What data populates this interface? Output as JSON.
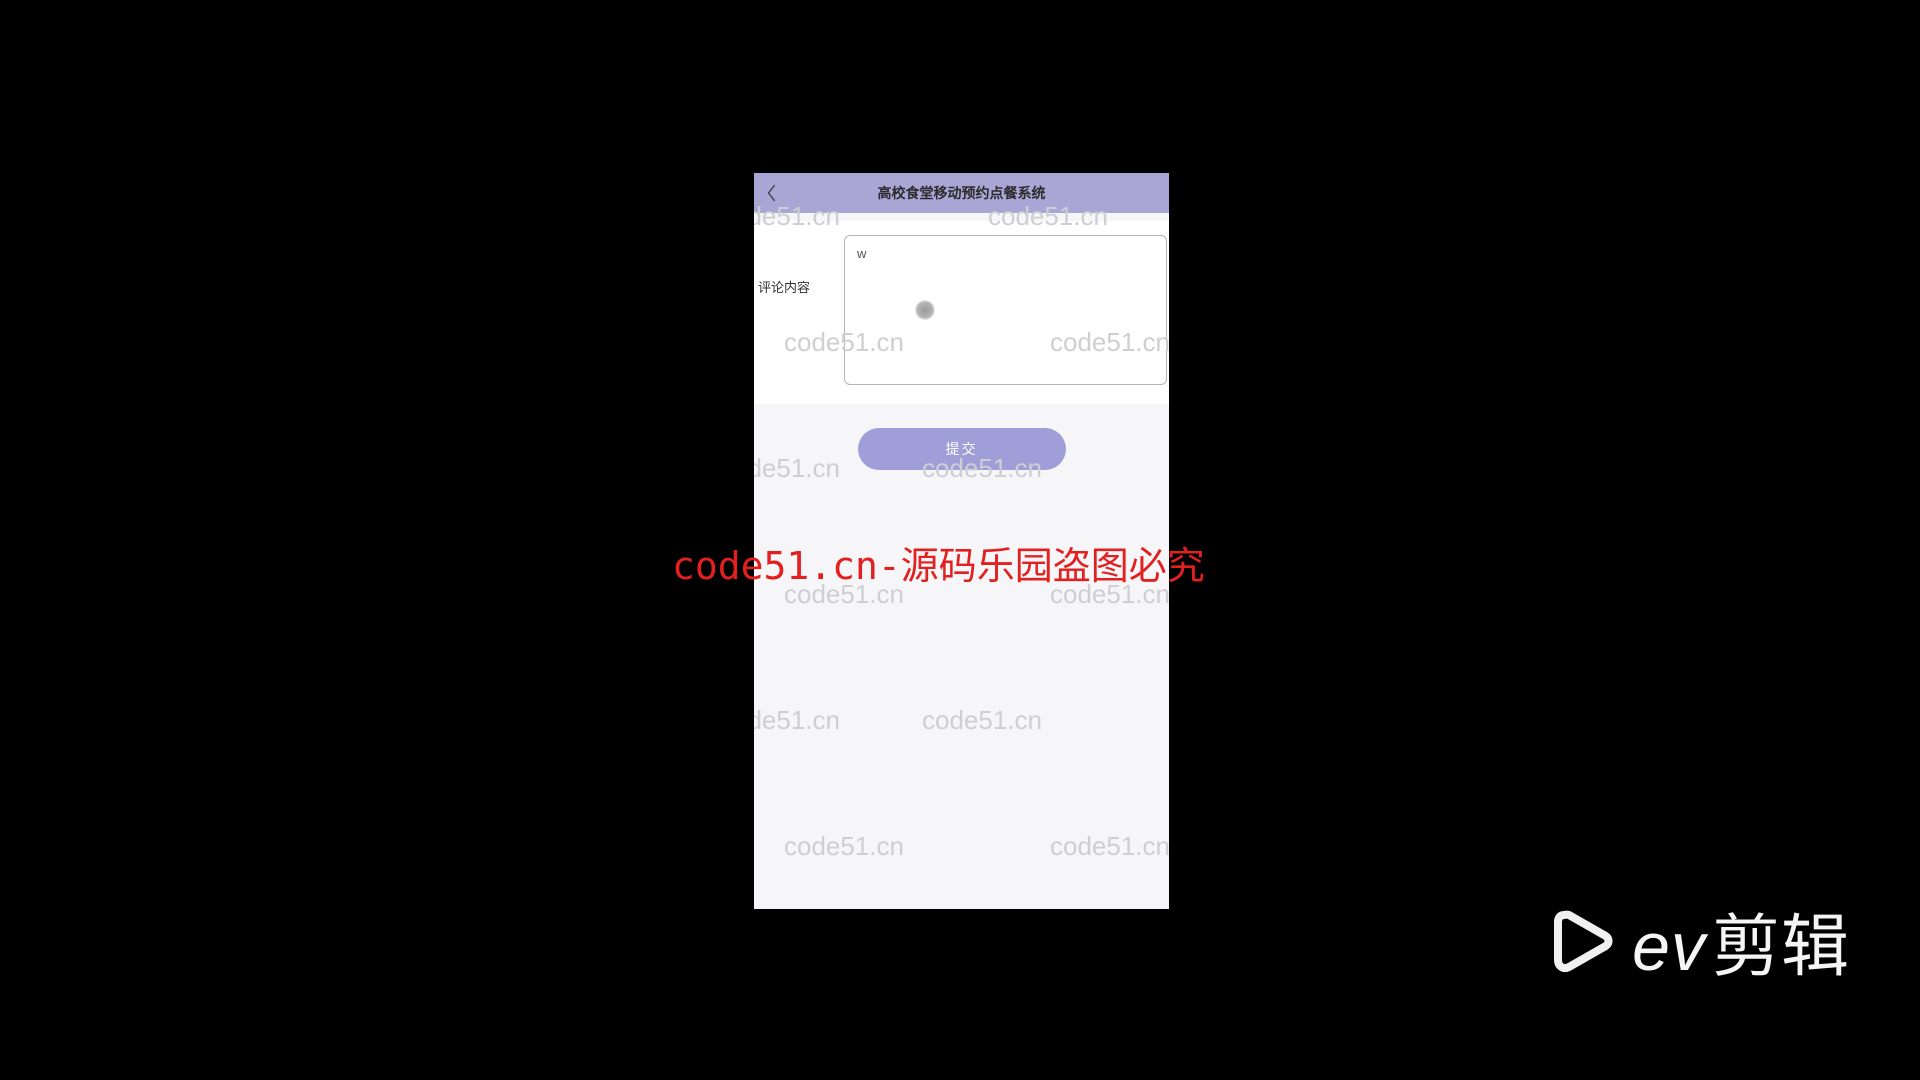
{
  "header": {
    "title": "高校食堂移动预约点餐系统"
  },
  "form": {
    "comment_label": "评论内容",
    "comment_value": "w",
    "submit_label": "提交"
  },
  "watermark": {
    "text": "code51.cn"
  },
  "overlay": {
    "red_text": "code51.cn-源码乐园盗图必究"
  },
  "logo": {
    "brand_en": "ev",
    "brand_cn": "剪辑"
  }
}
